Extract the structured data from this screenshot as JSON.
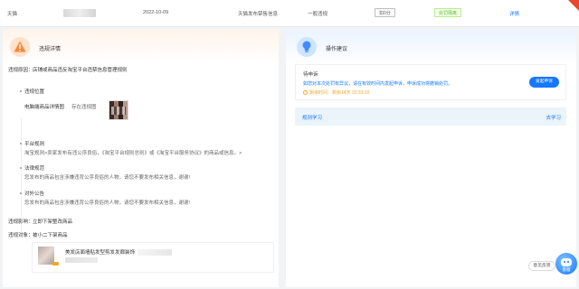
{
  "record": {
    "platform": "天猫",
    "date": "2022-10-09",
    "category": "天猫发布禁售信息",
    "level": "一般违规",
    "score": "扣0分",
    "status": "处罚隔离",
    "detail_link": "详情"
  },
  "left_panel": {
    "title": "违规详情",
    "reason_label": "违规原因：",
    "reason_text": "店铺或商品违反淘宝平台违禁信息管理规则",
    "location": {
      "title": "违规位置",
      "label": "电脑端商品详情图",
      "value": "存在违规图"
    },
    "platform_rule": {
      "title": "平台规则",
      "text": "淘宝规则>卖家发布有违公序良俗，《淘宝平台规则总则》或《淘宝平台服务协议》的商品或信息。>"
    },
    "law": {
      "title": "法律规范",
      "text": "您发布的商品包含涉嫌违背公序良俗的人物，请您不要发布相关信息，谢谢!"
    },
    "notice": {
      "title": "对外公告",
      "text": "您发布的商品包含涉嫌违背公序良俗的人物，请您不要发布相关信息，谢谢!"
    },
    "impact_label": "违规影响：",
    "impact_text": "立即下架整改商品",
    "target_label": "违规对象：",
    "target_text": "被小二下架商品",
    "product_name": "美发店面墙贴发型剪发发廊装饰"
  },
  "right_panel": {
    "title": "操作建议",
    "appeal": {
      "title": "待申诉",
      "desc": "如您对本次处罚有异议，请在有效时间内发起申诉，申诉成功将撤销处罚。",
      "deadline_prefix": "剩余时间：",
      "deadline_value": "剩余14天 22:33:10",
      "button": "发起申诉"
    },
    "learn": {
      "title": "规则学习",
      "link": "去学习"
    }
  },
  "floating": {
    "feedback": "意见反馈",
    "service": "客服"
  },
  "colors": {
    "primary": "#1677ff",
    "warning": "#f5a623",
    "success": "#52c41a"
  }
}
